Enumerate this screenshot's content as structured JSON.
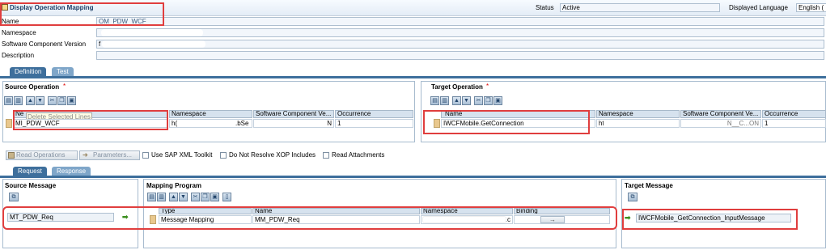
{
  "window": {
    "title": "Display Operation Mapping"
  },
  "status": {
    "label": "Status",
    "value": "Active"
  },
  "language": {
    "label": "Displayed Language",
    "value": "English ("
  },
  "fields": {
    "name_label": "Name",
    "name_value": "OM_PDW_WCF",
    "namespace_label": "Namespace",
    "namespace_value": "",
    "swc_label": "Software Component Version",
    "swc_value": "f",
    "description_label": "Description",
    "description_value": ""
  },
  "tabs": {
    "definition": "Definition",
    "test": "Test",
    "request": "Request",
    "response": "Response"
  },
  "source_operation": {
    "title": "Source Operation",
    "required_mark": "*",
    "tooltip": "Delete Selected Lines",
    "columns": {
      "name": "Ne",
      "namespace": "Namespace",
      "swc": "Software Component Ve...",
      "occurrence": "Occurrence"
    },
    "row": {
      "name": "MI_PDW_WCF",
      "namespace": "h(",
      "namespace_tail": ".bSe",
      "swc": "N",
      "occurrence": "1"
    }
  },
  "target_operation": {
    "title": "Target Operation",
    "required_mark": "*",
    "columns": {
      "name": "Name",
      "namespace": "Namespace",
      "swc": "Software Component Ve...",
      "occurrence": "Occurrence"
    },
    "row": {
      "name": "IWCFMobile.GetConnection",
      "namespace": "ht",
      "swc": "N__C...ON",
      "occurrence": "1"
    }
  },
  "options": {
    "read_operations": "Read Operations",
    "parameters": "Parameters...",
    "use_sap_xml": "Use SAP XML Toolkit",
    "do_not_resolve": "Do Not Resolve XOP Includes",
    "read_attachments": "Read Attachments"
  },
  "source_message": {
    "title": "Source Message",
    "value": "MT_PDW_Req"
  },
  "mapping_program": {
    "title": "Mapping Program",
    "columns": {
      "type": "Type",
      "name": "Name",
      "namespace": "Namespace",
      "binding": "Binding"
    },
    "row": {
      "type": "Message Mapping",
      "name": "MM_PDW_Req",
      "namespace": ".c",
      "binding": "→"
    }
  },
  "target_message": {
    "title": "Target Message",
    "value": "IWCFMobile_GetConnection_InputMessage"
  },
  "colors": {
    "tab_active": "#3e6f9c",
    "highlight_red": "#e03e3e",
    "selector": "#e9c88e"
  }
}
